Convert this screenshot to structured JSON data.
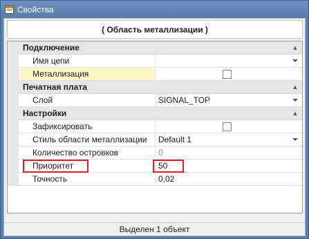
{
  "window": {
    "title": "Свойства",
    "icon": "properties-icon"
  },
  "header": {
    "text": "( Область металлизации )"
  },
  "categories": [
    {
      "label": "Подключение",
      "rows": [
        {
          "name": "Имя цепи",
          "value": ""
        },
        {
          "name": "Металлизация",
          "value": ""
        }
      ]
    },
    {
      "label": "Печатная плата",
      "rows": [
        {
          "name": "Слой",
          "value": "SIGNAL_TOP"
        }
      ]
    },
    {
      "label": "Настройки",
      "rows": [
        {
          "name": "Зафиксировать",
          "value": ""
        },
        {
          "name": "Стиль области металлизации",
          "value": "Default 1"
        },
        {
          "name": "Количество островков",
          "value": "0"
        },
        {
          "name": "Приоритет",
          "value": "50"
        },
        {
          "name": "Точность",
          "value": "0,02"
        }
      ]
    }
  ],
  "status": {
    "text": "Выделен 1 объект"
  },
  "colors": {
    "titlebar": "#5b80b0",
    "highlight_row": "#fff6c8",
    "annotation_box": "#e8192c"
  }
}
